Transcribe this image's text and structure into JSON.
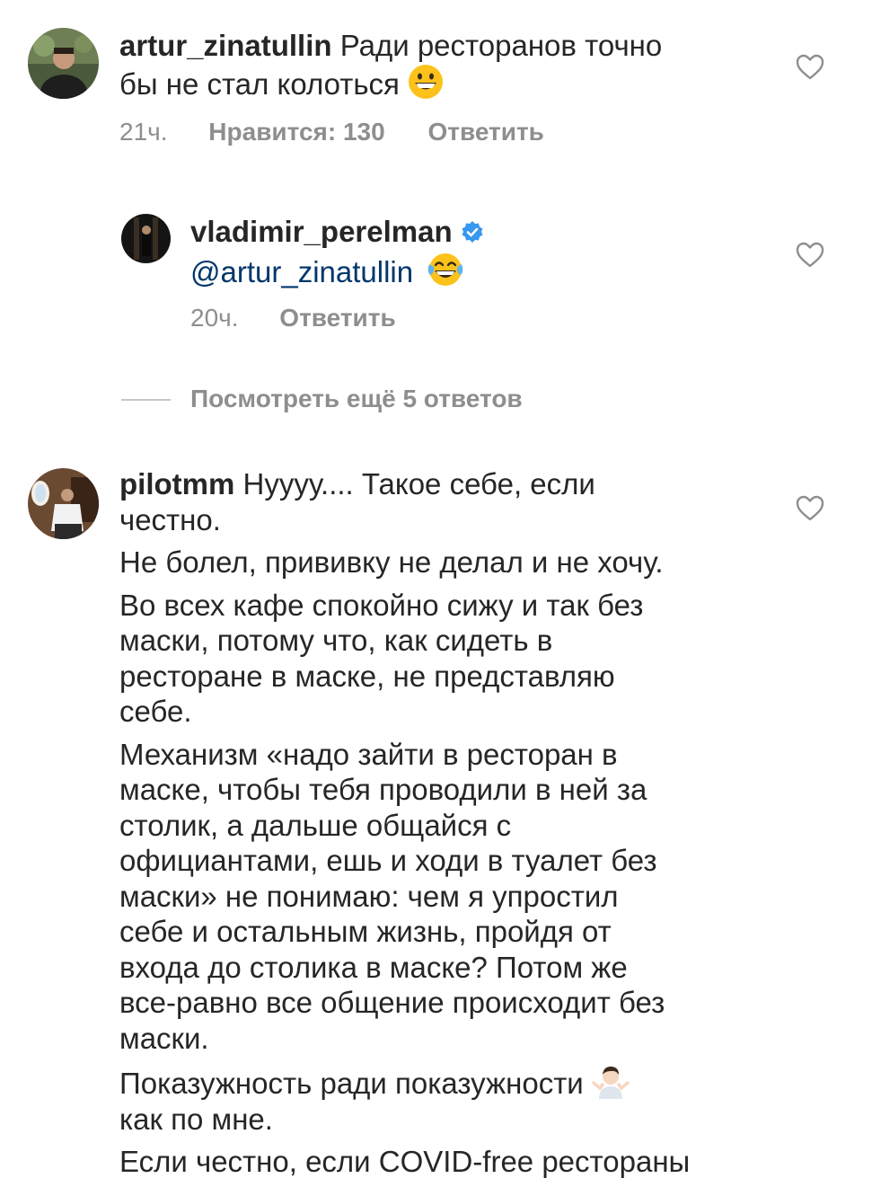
{
  "comments": [
    {
      "username": "artur_zinatullin",
      "text": " Ради ресторанов точно бы не стал колоться ",
      "text_line1": " Ради ресторанов точно",
      "text_line2": "бы не стал колоться ",
      "time": "21ч.",
      "likes": "Нравится: 130",
      "reply": "Ответить"
    },
    {
      "username": "vladimir_perelman",
      "mention": "@artur_zinatullin",
      "time": "20ч.",
      "reply": "Ответить"
    }
  ],
  "view_more": "Посмотреть ещё 5 ответов",
  "pilot": {
    "username": "pilotmm",
    "p1_l1": " Нуууу.... Такое себе, если",
    "p1_l2": "честно.",
    "p2": "Не болел, прививку не делал и не хочу.",
    "p3_l1": "Во всех кафе спокойно сижу и так без",
    "p3_l2": "маски, потому что, как сидеть в",
    "p3_l3": "ресторане в маске, не представляю",
    "p3_l4": "себе.",
    "p4_l1": "Механизм «надо зайти в ресторан в",
    "p4_l2": "маске, чтобы тебя проводили в ней за",
    "p4_l3": "столик, а дальше общайся с",
    "p4_l4": "официантами, ешь и ходи в туалет без",
    "p4_l5": "маски» не понимаю: чем я упростил",
    "p4_l6": "себе и остальным жизнь, пройдя от",
    "p4_l7": "входа до столика в маске? Потом же",
    "p4_l8": "все-равно все общение происходит без",
    "p4_l9": "маски.",
    "p5_l1": "Показужность ради показужности ",
    "p5_l2": "как по мне.",
    "p6_l1": "Если честно, если COVID-free рестораны"
  },
  "icons": {
    "heart": "heart-outline-icon",
    "verified": "verified-badge-icon",
    "grinning": "grinning-face-emoji",
    "tears_of_joy": "face-with-tears-of-joy-emoji",
    "shrug": "person-shrugging-emoji"
  },
  "colors": {
    "text": "#262626",
    "meta": "#8e8e8e",
    "mention": "#00376b",
    "verified": "#3897f0"
  }
}
